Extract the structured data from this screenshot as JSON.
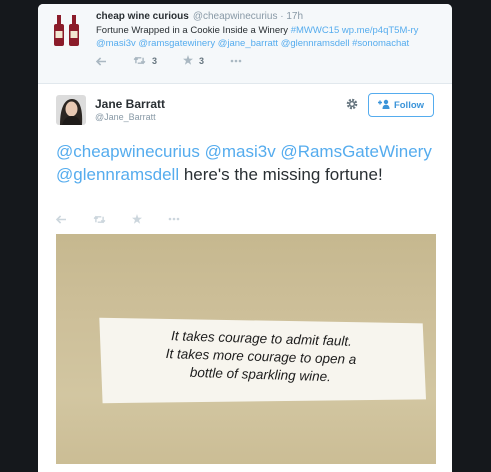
{
  "parent_tweet": {
    "name": "cheap wine curious",
    "handle_time": "@cheapwinecurius · 17h",
    "text_line1": "Fortune Wrapped in a Cookie Inside a Winery",
    "text_line1_links": "#MWWC15 wp.me/p4qT5M-ry",
    "text_line2_links": "@masi3v @ramsgatewinery @jane_barratt @glennramsdell #sonomachat",
    "retweet_count": "3",
    "favorite_count": "3",
    "icons": [
      "reply-icon",
      "retweet-icon",
      "favorite-icon",
      "more-icon"
    ]
  },
  "tweet": {
    "name": "Jane Barratt",
    "handle": "@Jane_Barratt",
    "follow_label": "Follow",
    "text_links": "@cheapwinecurius @masi3v @RamsGateWinery @glennramsdell",
    "text_rest": "here's the missing fortune!",
    "icons": [
      "reply-icon",
      "retweet-icon",
      "favorite-icon",
      "more-icon"
    ]
  },
  "photo": {
    "fortune_line1": "It takes courage to admit fault.",
    "fortune_line2": "It takes more courage to open a",
    "fortune_line3": "bottle of sparkling wine."
  },
  "colors": {
    "background": "#15181c",
    "link": "#55acee",
    "follow_text": "#3b94d9",
    "icon_gray": "#ccd6dd",
    "wine_red": "#8b1c2a"
  }
}
